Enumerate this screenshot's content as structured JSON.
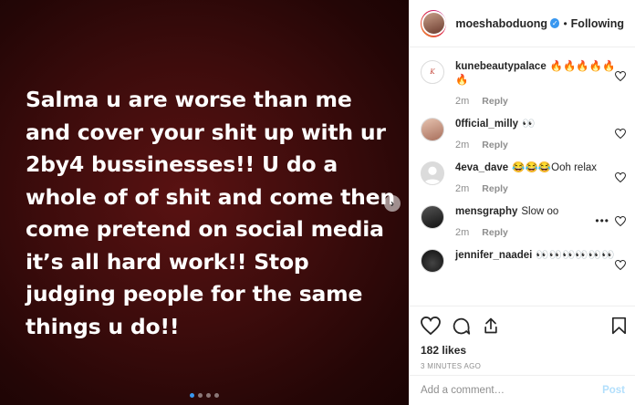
{
  "post": {
    "text": "Salma u are worse than me\nand cover your shit up with ur\n2by4 bussinesses!! U do a\nwhole of of shit and come then\ncome pretend on social media\nit’s all hard work!! Stop\njudging  people for the same\nthings u do!!",
    "next_icon": "chevron-right-icon",
    "carousel_dots": 4,
    "active_dot": 0
  },
  "header": {
    "username": "moeshaboduong",
    "verified_icon": "verified-badge-icon",
    "separator": "•",
    "follow_status": "Following"
  },
  "comments": [
    {
      "username": "kunebeautypalace",
      "text": "🔥🔥🔥🔥🔥🔥",
      "time": "2m",
      "reply_label": "Reply",
      "avatar_color": "#ffffff",
      "show_more": false
    },
    {
      "username": "0fficial_milly",
      "text": "👀",
      "time": "2m",
      "reply_label": "Reply",
      "avatar_color": "#c8a08c",
      "show_more": false
    },
    {
      "username": "4eva_dave",
      "text": "😂😂😂Ooh relax",
      "time": "2m",
      "reply_label": "Reply",
      "avatar_color": "#dbdbdb",
      "show_more": false
    },
    {
      "username": "mensgraphy",
      "text": "Slow oo",
      "time": "2m",
      "reply_label": "Reply",
      "avatar_color": "#2a2a2a",
      "show_more": true
    },
    {
      "username": "jennifer_naadei",
      "text": "👀👀👀👀👀👀",
      "time": "",
      "reply_label": "",
      "avatar_color": "#1e1e1e",
      "show_more": false
    }
  ],
  "actions": {
    "like_icon": "heart-icon",
    "comment_icon": "comment-icon",
    "share_icon": "share-icon",
    "save_icon": "bookmark-icon",
    "likes_count": "182 likes",
    "timestamp": "3 MINUTES AGO"
  },
  "add_comment": {
    "placeholder": "Add a comment…",
    "post_label": "Post"
  },
  "colors": {
    "accent": "#3897f0",
    "post_disabled": "#b2dffc",
    "muted": "#8e8e8e"
  }
}
